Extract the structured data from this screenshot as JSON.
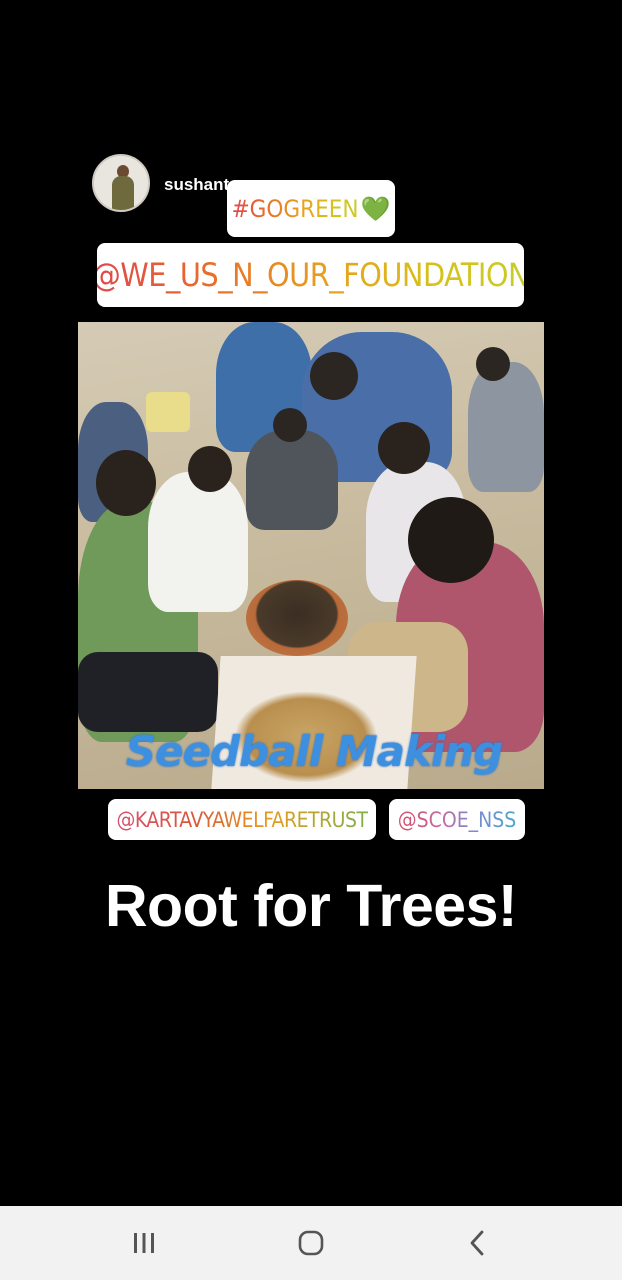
{
  "story": {
    "username": "sushantsy",
    "stickers": {
      "hashtag": "#GOGREEN",
      "hashtag_emoji": "💚",
      "foundation": "@WE_US_N_OUR_FOUNDATION",
      "trust": "@KARTAVYAWELFARETRUST",
      "nss": "@SCOE_NSS"
    },
    "photo_caption": "Seedball Making",
    "headline": "Root for Trees!"
  },
  "navbar": {
    "recents_icon": "recent-apps-icon",
    "home_icon": "home-icon",
    "back_icon": "back-icon"
  },
  "colors": {
    "background": "#000000",
    "navbar": "#f2f2f2",
    "caption": "#3d8fe0"
  }
}
